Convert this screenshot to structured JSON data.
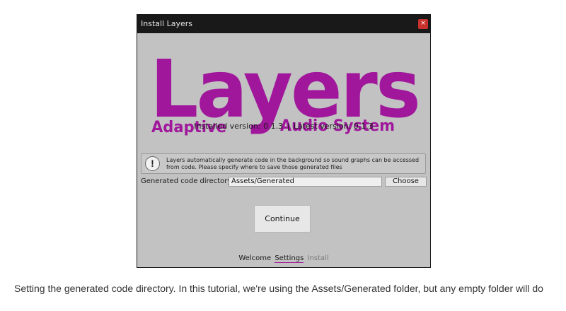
{
  "window": {
    "title": "Install Layers",
    "close_glyph": "×",
    "close_color": "#c8322c"
  },
  "logo": {
    "title": "Layers",
    "subtitle_left": "Adaptive",
    "subtitle_right": "Audio System",
    "brand_color": "#a0179c"
  },
  "version": {
    "installed": "Installed version: 0.1.3",
    "separator": "|",
    "latest": "Latest version: 0.1.3"
  },
  "info": {
    "icon": "exclamation-icon",
    "line1": "Layers automatically generate code in the background so sound graphs can be accessed",
    "line2": "from code. Please specify where to save those generated files"
  },
  "directory": {
    "label": "Generated code directory",
    "value": "Assets/Generated",
    "choose_label": "Choose"
  },
  "continue_label": "Continue",
  "steps": [
    {
      "label": "Welcome",
      "state": "done"
    },
    {
      "label": "Settings",
      "state": "current"
    },
    {
      "label": "Install",
      "state": "pending"
    }
  ],
  "caption": "Setting the generated code directory. In this tutorial, we're using the Assets/Generated folder, but any empty folder will do"
}
